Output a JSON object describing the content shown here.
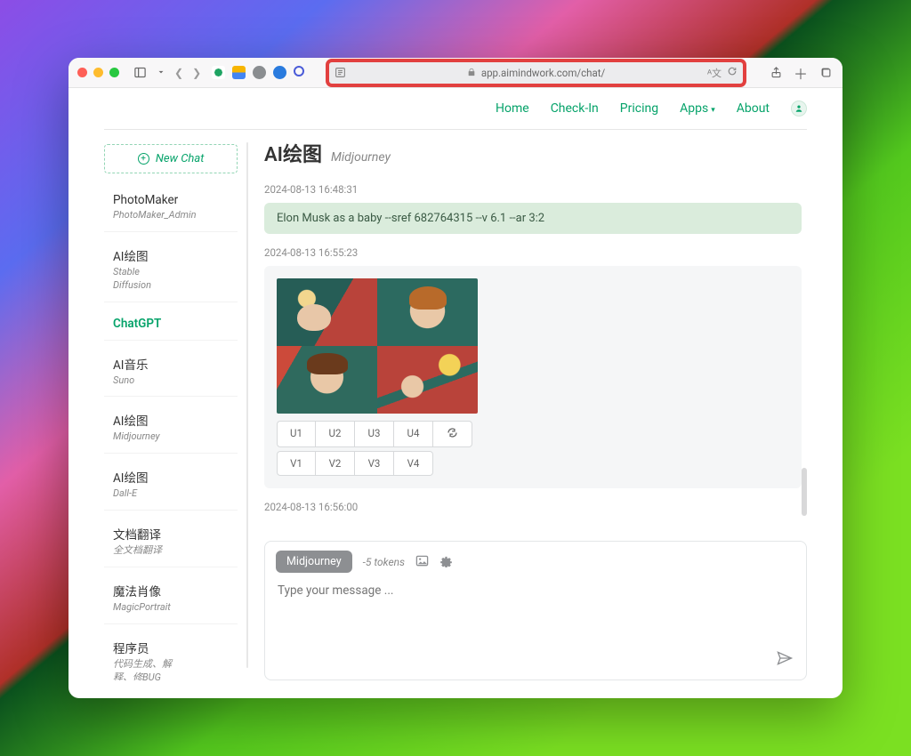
{
  "browser": {
    "url": "app.aimindwork.com/chat/"
  },
  "nav": {
    "items": [
      "Home",
      "Check-In",
      "Pricing",
      "Apps",
      "About"
    ],
    "apps_has_dropdown": true
  },
  "sidebar": {
    "new_chat_label": "New Chat",
    "items": [
      {
        "name": "PhotoMaker",
        "sub": "PhotoMaker_Admin",
        "active": false
      },
      {
        "name": "AI绘图",
        "sub": "Stable\nDiffusion",
        "active": false
      },
      {
        "name": "ChatGPT",
        "sub": "",
        "active": true
      },
      {
        "name": "AI音乐",
        "sub": "Suno",
        "active": false
      },
      {
        "name": "AI绘图",
        "sub": "Midjourney",
        "active": false
      },
      {
        "name": "AI绘图",
        "sub": "Dall-E",
        "active": false
      },
      {
        "name": "文档翻译",
        "sub": "全文档翻译",
        "active": false
      },
      {
        "name": "魔法肖像",
        "sub": "MagicPortrait",
        "active": false
      },
      {
        "name": "程序员",
        "sub": "代码生成、解\n释、修BUG",
        "active": false
      }
    ]
  },
  "chat": {
    "title": "AI绘图",
    "subtitle": "Midjourney",
    "timestamps": {
      "t1": "2024-08-13 16:48:31",
      "t2": "2024-08-13 16:55:23",
      "t3": "2024-08-13 16:56:00"
    },
    "user_prompt": "Elon Musk as a baby --sref 682764315 --v 6.1 --ar 3:2",
    "grid_buttons_u": [
      "U1",
      "U2",
      "U3",
      "U4"
    ],
    "grid_buttons_v": [
      "V1",
      "V2",
      "V3",
      "V4"
    ]
  },
  "composer": {
    "engine_label": "Midjourney",
    "token_hint": "-5 tokens",
    "placeholder": "Type your message ..."
  }
}
